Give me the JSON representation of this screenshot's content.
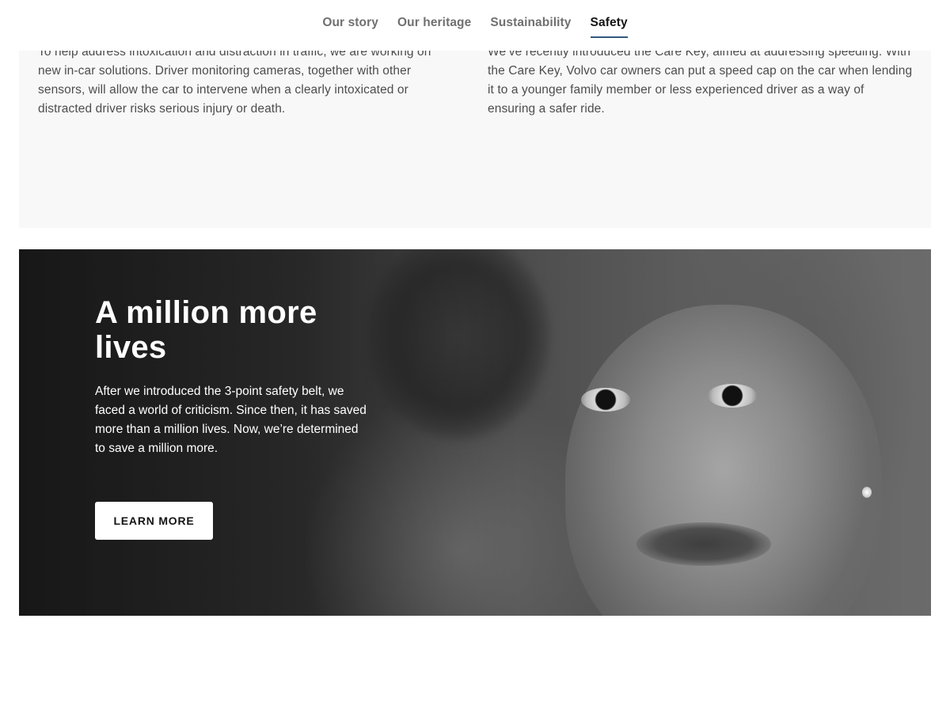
{
  "nav": {
    "tabs": [
      {
        "label": "Our story",
        "active": false
      },
      {
        "label": "Our heritage",
        "active": false
      },
      {
        "label": "Sustainability",
        "active": false
      },
      {
        "label": "Safety",
        "active": true
      }
    ]
  },
  "features": {
    "left_text": "To help address intoxication and distraction in traffic, we are working on new in-car solutions. Driver monitoring cameras, together with other sensors, will allow the car to intervene when a clearly intoxicated or distracted driver risks serious injury or death.",
    "right_text": "We’ve recently introduced the Care Key, aimed at addressing speeding. With the Care Key, Volvo car owners can put a speed cap on the car when lending it to a younger family member or less experienced driver as a way of ensuring a safer ride."
  },
  "hero": {
    "title": "A million more lives",
    "body": "After we introduced the 3-point safety belt, we faced a world of criticism. Since then, it has saved more than a million lives. Now, we’re determined to save a million more.",
    "button_label": "LEARN MORE"
  },
  "colors": {
    "active_underline": "#2a5b8c",
    "panel_bg": "#f8f8f8"
  }
}
